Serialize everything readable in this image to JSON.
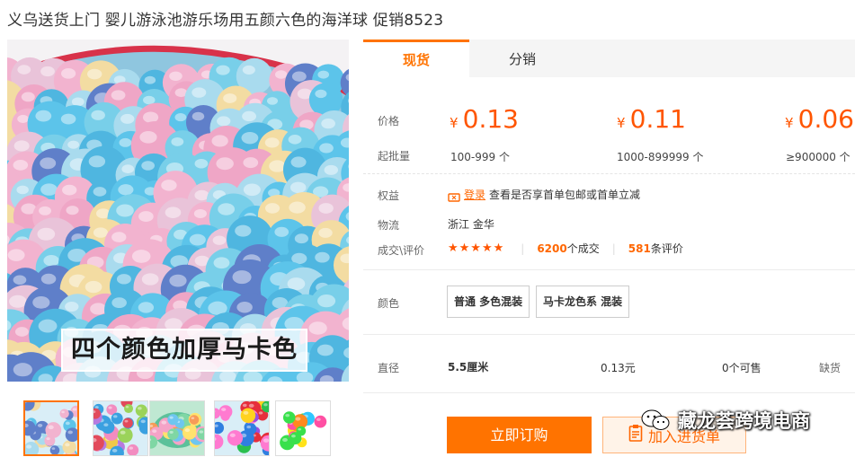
{
  "title": "义乌送货上门 婴儿游泳池游乐场用五颜六色的海洋球 促销8523",
  "main_image": {
    "caption": "四个颜色加厚马卡色",
    "description_icon": "ocean-balls-photo"
  },
  "thumbnails": [
    {
      "name": "thumb-pastel-balls"
    },
    {
      "name": "thumb-mixed-balls"
    },
    {
      "name": "thumb-ball-pool"
    },
    {
      "name": "thumb-bright-balls"
    },
    {
      "name": "thumb-neon-balls"
    }
  ],
  "tabs": [
    {
      "label": "现货",
      "active": true
    },
    {
      "label": "分销",
      "active": false
    }
  ],
  "price_label": "价格",
  "moq_label": "起批量",
  "currency_symbol": "¥",
  "price_tiers": [
    {
      "price": "0.13",
      "qty": "100-999 个"
    },
    {
      "price": "0.11",
      "qty": "1000-899999 个"
    },
    {
      "price": "0.06",
      "qty": "≥900000 个"
    }
  ],
  "benefits": {
    "label": "权益",
    "login_text": "登录",
    "text": "查看是否享首单包邮或首单立减"
  },
  "logistics": {
    "label": "物流",
    "value": "浙江 金华"
  },
  "deal_review": {
    "label": "成交\\评价",
    "stars": "★★★★★",
    "deals_count": "6200",
    "deals_suffix": "个成交",
    "reviews_count": "581",
    "reviews_suffix": "条评价",
    "separator": "|"
  },
  "color_option": {
    "label": "颜色",
    "options": [
      "普通 多色混装",
      "马卡龙色系 混装"
    ]
  },
  "spec_row": {
    "label": "直径",
    "size": "5.5厘米",
    "price": "0.13元",
    "stock": "0个可售",
    "status": "缺货"
  },
  "actions": {
    "buy_now": "立即订购",
    "add_to_cart": "加入进货单"
  },
  "watermark": "藏龙荟跨境电商",
  "colors": {
    "accent": "#ff7300",
    "price": "#ff5500"
  }
}
